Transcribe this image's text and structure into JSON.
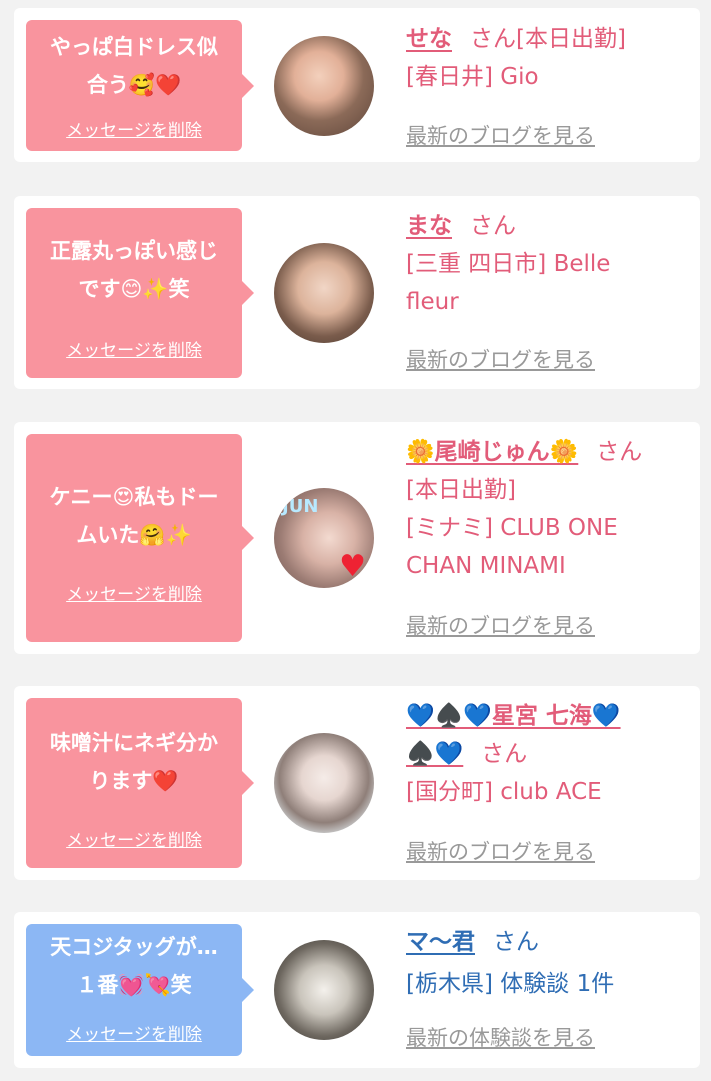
{
  "delete_label": "メッセージを削除",
  "colors": {
    "pink_bubble": "#f9949e",
    "blue_bubble": "#8cb7f4",
    "pink_text": "#e25c79",
    "blue_text": "#2f6db4"
  },
  "items": [
    {
      "message": [
        "やっぱ白ドレス似",
        "合う🥰❤️"
      ],
      "name": "せな",
      "san": "さん",
      "details": [
        "[本日出勤]",
        "[春日井] Gio"
      ],
      "link": "最新のブログを見る"
    },
    {
      "message": [
        "正露丸っぽい感じ",
        "です😊✨笑"
      ],
      "name": "まな",
      "san": "さん",
      "details": [
        "[三重 四日市] Belle",
        "fleur"
      ],
      "link": "最新のブログを見る"
    },
    {
      "message": [
        "ケニー😍私もドー",
        "ムいた🤗✨"
      ],
      "name": "🌼尾崎じゅん🌼",
      "san": "さん",
      "details": [
        "[本日出勤]",
        "[ミナミ] CLUB ONE",
        "CHAN MINAMI"
      ],
      "link": "最新のブログを見る",
      "avatar_text": "JUN"
    },
    {
      "message": [
        "味噌汁にネギ分か",
        "ります❤️"
      ],
      "name": "💙♠️💙星宮 七海💙",
      "name2": "♠️💙",
      "san": "さん",
      "details": [
        "[国分町] club ACE"
      ],
      "link": "最新のブログを見る"
    },
    {
      "message": [
        "天コジタッグが…",
        "１番💓💘笑"
      ],
      "name": "マ〜君",
      "san": "さん",
      "details": [
        "[栃木県] 体験談 1件"
      ],
      "link": "最新の体験談を見る"
    }
  ]
}
